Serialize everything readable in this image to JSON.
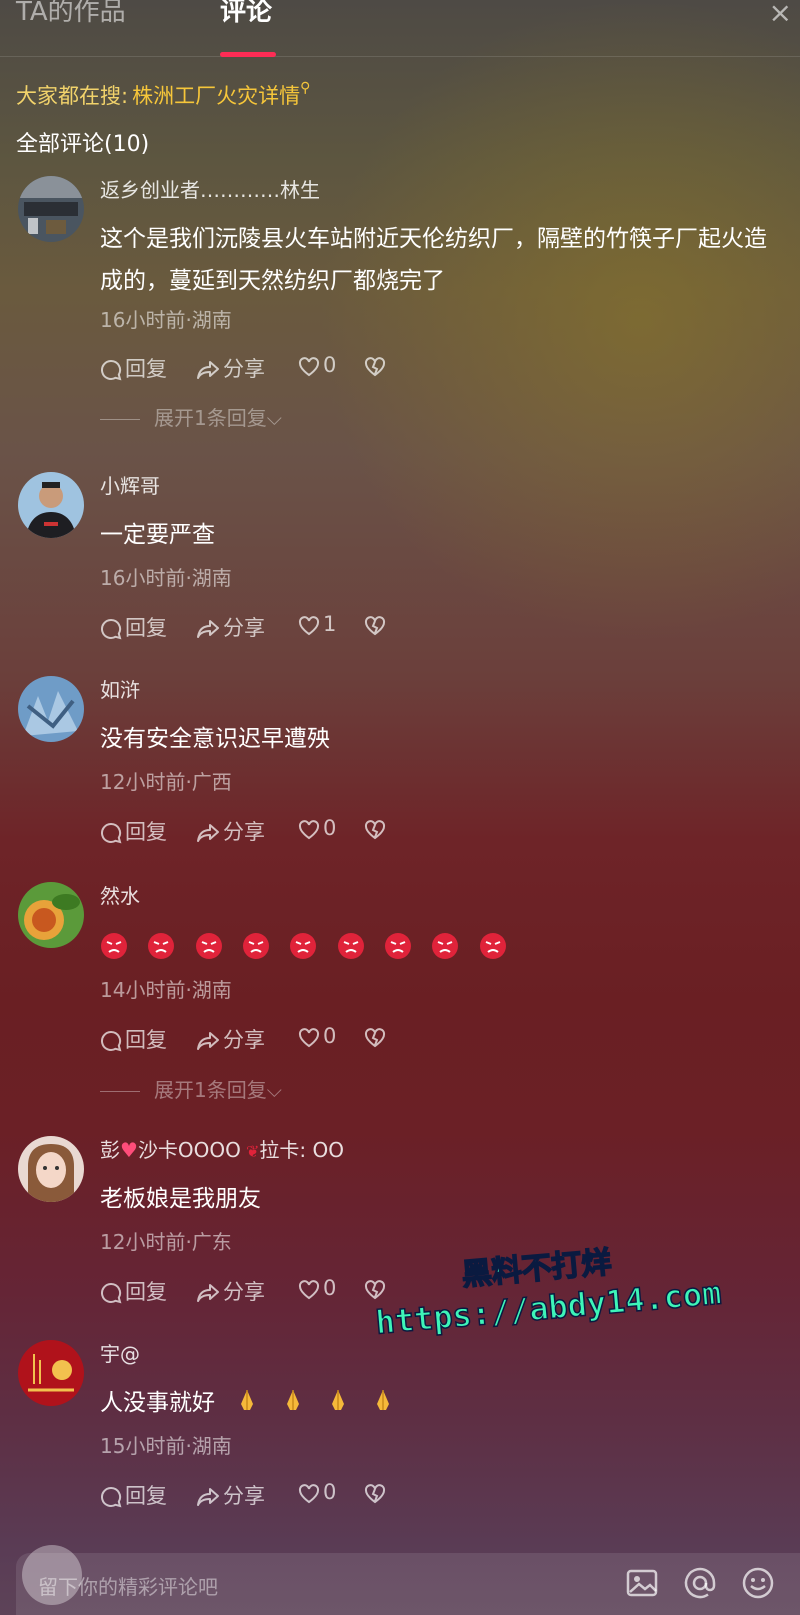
{
  "tabs": {
    "works": "TA的作品",
    "comments": "评论",
    "close": "×"
  },
  "hot_search": {
    "label": "大家都在搜:",
    "keyword": "株洲工厂火灾详情"
  },
  "total_comments": "全部评论(10)",
  "actions": {
    "reply": "回复",
    "share": "分享"
  },
  "comments": [
    {
      "user": "返乡创业者…………林生",
      "text": "这个是我们沅陵县火车站附近天伦纺织厂，隔壁的竹筷子厂起火造成的，蔓延到天然纺织厂都烧完了",
      "meta": "16小时前·湖南",
      "likes": "0",
      "expand": "展开1条回复"
    },
    {
      "user": "小辉哥",
      "text": "一定要严查",
      "meta": "16小时前·湖南",
      "likes": "1"
    },
    {
      "user": "如浒",
      "text": "没有安全意识迟早遭殃",
      "meta": "12小时前·广西",
      "likes": "0"
    },
    {
      "user": "然水",
      "text": "",
      "meta": "14小时前·湖南",
      "likes": "0",
      "expand": "展开1条回复"
    },
    {
      "user_a": "彭",
      "user_b": "沙卡OOOO",
      "user_c": "拉卡: OO",
      "text": "老板娘是我朋友",
      "meta": "12小时前·广东",
      "likes": "0"
    },
    {
      "user": "宇@",
      "text": "人没事就好",
      "meta": "15小时前·湖南",
      "likes": "0"
    }
  ],
  "watermark": {
    "line1": "黑料不打烊",
    "line2": "https://abdy14.com"
  },
  "input": {
    "placeholder": "留下你的精彩评论吧"
  },
  "colors": {
    "accent": "#fe2c55",
    "hot_keyword": "#f6c63a",
    "watermark": "#3ef5b8"
  }
}
